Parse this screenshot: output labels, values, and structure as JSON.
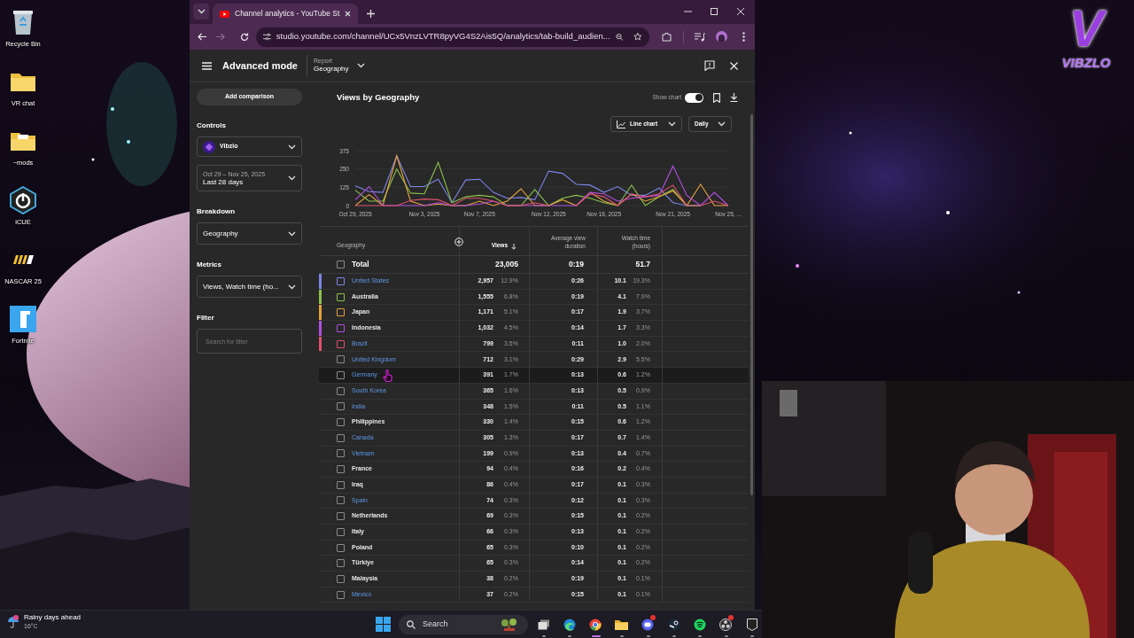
{
  "desktop": {
    "icons": [
      {
        "label": "Recycle Bin",
        "kind": "bin"
      },
      {
        "label": "VR chat",
        "kind": "folder"
      },
      {
        "label": "~mods",
        "kind": "docfolder"
      },
      {
        "label": "iCUE",
        "kind": "icue"
      },
      {
        "label": "NASCAR 25",
        "kind": "nascar"
      },
      {
        "label": "Fortnite",
        "kind": "fortnite"
      }
    ],
    "logo": {
      "mark": "V",
      "wordmark": "VIBZLO"
    }
  },
  "browser": {
    "tab_title": "Channel analytics - YouTube St",
    "url": "studio.youtube.com/channel/UCx5VnzLVTR8pyVG4S2Ais5Q/analytics/tab-build_audien...",
    "forward_disabled": true
  },
  "studio": {
    "header": {
      "title": "Advanced mode",
      "report_label": "Report",
      "report_value": "Geography"
    },
    "sidebar": {
      "add_button": "Add comparison",
      "sections": [
        {
          "heading": "Controls",
          "controls": [
            {
              "kind": "channel",
              "value": "Vibzlo"
            },
            {
              "kind": "date",
              "caption": "Oct 29 – Nov 25, 2025",
              "value": "Last 28 days"
            }
          ]
        },
        {
          "heading": "Breakdown",
          "controls": [
            {
              "kind": "select",
              "value": "Geography"
            }
          ]
        },
        {
          "heading": "Metrics",
          "controls": [
            {
              "kind": "select",
              "value": "Views, Watch time (ho..."
            }
          ]
        },
        {
          "heading": "Filter",
          "controls": [
            {
              "kind": "search",
              "placeholder": "Search for filter"
            }
          ]
        }
      ]
    },
    "main": {
      "title": "Views by Geography",
      "show_chart_label": "Show chart",
      "show_chart": {
        "on": true
      },
      "chart_type": "Line chart",
      "interval": "Daily",
      "chart_data": {
        "type": "line",
        "categories": [
          "Oct 29, 2025",
          null,
          null,
          null,
          null,
          "Nov 3, 2025",
          null,
          null,
          null,
          "Nov 7, 2025",
          null,
          null,
          null,
          null,
          "Nov 12, 2025",
          null,
          null,
          null,
          "Nov 16, 2025",
          null,
          null,
          null,
          null,
          "Nov 21, 2025",
          null,
          null,
          null,
          "Nov 25, ..."
        ],
        "ylim": [
          0,
          375
        ],
        "yticks": [
          0,
          125,
          250,
          375
        ],
        "series": [
          {
            "color": "#7b86e8",
            "values": [
              135,
              95,
              90,
              340,
              130,
              130,
              180,
              20,
              175,
              180,
              90,
              50,
              55,
              40,
              235,
              220,
              145,
              140,
              90,
              130,
              70,
              70,
              120,
              20,
              0,
              0,
              null,
              null
            ]
          },
          {
            "color": "#8bc34a",
            "values": [
              105,
              30,
              30,
              250,
              85,
              80,
              295,
              20,
              60,
              70,
              60,
              0,
              0,
              110,
              0,
              50,
              70,
              50,
              20,
              0,
              140,
              0,
              60,
              110,
              0,
              0,
              null,
              null
            ]
          },
          {
            "color": "#e6a23c",
            "values": [
              0,
              75,
              0,
              340,
              30,
              0,
              10,
              0,
              0,
              30,
              0,
              30,
              115,
              0,
              0,
              40,
              0,
              90,
              30,
              0,
              80,
              30,
              60,
              100,
              0,
              145,
              0,
              0
            ]
          },
          {
            "color": "#b44de0",
            "values": [
              40,
              130,
              0,
              0,
              0,
              0,
              20,
              0,
              0,
              10,
              30,
              0,
              0,
              0,
              0,
              0,
              0,
              90,
              80,
              30,
              50,
              60,
              70,
              270,
              70,
              0,
              90,
              0
            ]
          },
          {
            "color": "#e0506e",
            "values": [
              0,
              0,
              0,
              0,
              35,
              45,
              40,
              0,
              50,
              50,
              30,
              0,
              0,
              20,
              0,
              null,
              0,
              80,
              60,
              0,
              80,
              60,
              80,
              140,
              0,
              0,
              30,
              0
            ]
          }
        ]
      },
      "table": {
        "columns": [
          "Geography",
          "Views",
          "Average view duration",
          "Watch time (hours)"
        ],
        "total": {
          "label": "Total",
          "checked": false,
          "views": "23,005",
          "avg_duration": "0:19",
          "watch_time": "51.7"
        },
        "rows": [
          {
            "name": "United States",
            "link": true,
            "color": "#7b86e8",
            "checked": false,
            "highlighted": false,
            "views": "2,957",
            "views_pct": "12.9%",
            "avg_duration": "0:26",
            "watch_time": "10.1",
            "watch_pct": "19.3%"
          },
          {
            "name": "Australia",
            "link": false,
            "color": "#8bc34a",
            "checked": false,
            "highlighted": false,
            "views": "1,555",
            "views_pct": "6.8%",
            "avg_duration": "0:19",
            "watch_time": "4.1",
            "watch_pct": "7.9%"
          },
          {
            "name": "Japan",
            "link": false,
            "color": "#e6a23c",
            "checked": false,
            "highlighted": false,
            "views": "1,171",
            "views_pct": "5.1%",
            "avg_duration": "0:17",
            "watch_time": "1.9",
            "watch_pct": "3.7%"
          },
          {
            "name": "Indonesia",
            "link": false,
            "color": "#b44de0",
            "checked": false,
            "highlighted": false,
            "views": "1,032",
            "views_pct": "4.5%",
            "avg_duration": "0:14",
            "watch_time": "1.7",
            "watch_pct": "3.3%"
          },
          {
            "name": "Brazil",
            "link": true,
            "color": "#e0506e",
            "checked": false,
            "highlighted": false,
            "views": "799",
            "views_pct": "3.5%",
            "avg_duration": "0:11",
            "watch_time": "1.0",
            "watch_pct": "2.0%"
          },
          {
            "name": "United Kingdom",
            "link": true,
            "checked": false,
            "highlighted": false,
            "views": "712",
            "views_pct": "3.1%",
            "avg_duration": "0:29",
            "watch_time": "2.9",
            "watch_pct": "5.5%"
          },
          {
            "name": "Germany",
            "link": true,
            "checked": false,
            "highlighted": true,
            "views": "391",
            "views_pct": "1.7%",
            "avg_duration": "0:13",
            "watch_time": "0.6",
            "watch_pct": "1.2%"
          },
          {
            "name": "South Korea",
            "link": true,
            "checked": false,
            "highlighted": false,
            "views": "365",
            "views_pct": "1.6%",
            "avg_duration": "0:13",
            "watch_time": "0.5",
            "watch_pct": "0.9%"
          },
          {
            "name": "India",
            "link": true,
            "checked": false,
            "highlighted": false,
            "views": "348",
            "views_pct": "1.5%",
            "avg_duration": "0:11",
            "watch_time": "0.5",
            "watch_pct": "1.1%"
          },
          {
            "name": "Philippines",
            "link": false,
            "checked": false,
            "highlighted": false,
            "views": "330",
            "views_pct": "1.4%",
            "avg_duration": "0:15",
            "watch_time": "0.6",
            "watch_pct": "1.2%"
          },
          {
            "name": "Canada",
            "link": true,
            "checked": false,
            "highlighted": false,
            "views": "305",
            "views_pct": "1.3%",
            "avg_duration": "0:17",
            "watch_time": "0.7",
            "watch_pct": "1.4%"
          },
          {
            "name": "Vietnam",
            "link": true,
            "checked": false,
            "highlighted": false,
            "views": "199",
            "views_pct": "0.9%",
            "avg_duration": "0:13",
            "watch_time": "0.4",
            "watch_pct": "0.7%"
          },
          {
            "name": "France",
            "link": false,
            "checked": false,
            "highlighted": false,
            "views": "94",
            "views_pct": "0.4%",
            "avg_duration": "0:16",
            "watch_time": "0.2",
            "watch_pct": "0.4%"
          },
          {
            "name": "Iraq",
            "link": false,
            "checked": false,
            "highlighted": false,
            "views": "86",
            "views_pct": "0.4%",
            "avg_duration": "0:17",
            "watch_time": "0.1",
            "watch_pct": "0.3%"
          },
          {
            "name": "Spain",
            "link": true,
            "checked": false,
            "highlighted": false,
            "views": "74",
            "views_pct": "0.3%",
            "avg_duration": "0:12",
            "watch_time": "0.1",
            "watch_pct": "0.3%"
          },
          {
            "name": "Netherlands",
            "link": false,
            "checked": false,
            "highlighted": false,
            "views": "69",
            "views_pct": "0.3%",
            "avg_duration": "0:15",
            "watch_time": "0.1",
            "watch_pct": "0.2%"
          },
          {
            "name": "Italy",
            "link": false,
            "checked": false,
            "highlighted": false,
            "views": "66",
            "views_pct": "0.3%",
            "avg_duration": "0:13",
            "watch_time": "0.1",
            "watch_pct": "0.2%"
          },
          {
            "name": "Poland",
            "link": false,
            "checked": false,
            "highlighted": false,
            "views": "65",
            "views_pct": "0.3%",
            "avg_duration": "0:10",
            "watch_time": "0.1",
            "watch_pct": "0.2%"
          },
          {
            "name": "Türkiye",
            "link": false,
            "checked": false,
            "highlighted": false,
            "views": "65",
            "views_pct": "0.3%",
            "avg_duration": "0:14",
            "watch_time": "0.1",
            "watch_pct": "0.2%"
          },
          {
            "name": "Malaysia",
            "link": false,
            "checked": false,
            "highlighted": false,
            "views": "38",
            "views_pct": "0.2%",
            "avg_duration": "0:19",
            "watch_time": "0.1",
            "watch_pct": "0.1%"
          },
          {
            "name": "Mexico",
            "link": true,
            "checked": false,
            "highlighted": false,
            "views": "37",
            "views_pct": "0.2%",
            "avg_duration": "0:15",
            "watch_time": "0.1",
            "watch_pct": "0.1%"
          }
        ]
      }
    }
  },
  "taskbar": {
    "weather": {
      "text": "Rainy days ahead",
      "temp": "16°C"
    },
    "search_placeholder": "Search",
    "apps": [
      {
        "kind": "taskview",
        "active": false,
        "badge": false
      },
      {
        "kind": "edge",
        "active": false,
        "badge": false
      },
      {
        "kind": "chrome",
        "active": true,
        "badge": false
      },
      {
        "kind": "files",
        "active": false,
        "badge": false
      },
      {
        "kind": "discord",
        "active": false,
        "badge": true
      },
      {
        "kind": "steam",
        "active": false,
        "badge": false
      },
      {
        "kind": "spotify",
        "active": false,
        "badge": false
      },
      {
        "kind": "obs",
        "active": false,
        "badge": true
      },
      {
        "kind": "epic",
        "active": false,
        "badge": false
      }
    ]
  }
}
